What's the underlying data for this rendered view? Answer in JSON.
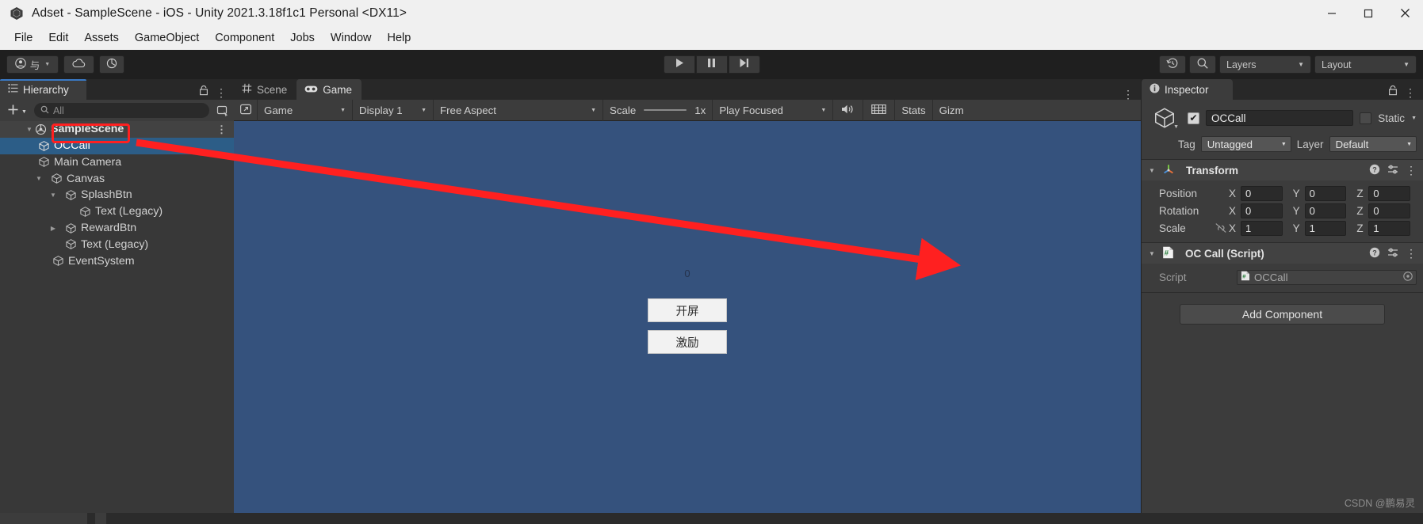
{
  "window": {
    "title": "Adset - SampleScene - iOS - Unity 2021.3.18f1c1 Personal <DX11>",
    "app_icon": "unity-logo-icon",
    "minimize": "minimize-icon",
    "maximize": "maximize-icon",
    "close": "close-icon"
  },
  "menubar": {
    "items": [
      {
        "label": "File"
      },
      {
        "label": "Edit"
      },
      {
        "label": "Assets"
      },
      {
        "label": "GameObject"
      },
      {
        "label": "Component"
      },
      {
        "label": "Jobs"
      },
      {
        "label": "Window"
      },
      {
        "label": "Help"
      }
    ]
  },
  "toolbar": {
    "account_label": "与",
    "account_icon": "account-icon",
    "cloud_icon": "cloud-icon",
    "collab_icon": "collab-icon",
    "play_icon": "play-icon",
    "pause_icon": "pause-icon",
    "step_icon": "step-icon",
    "undo_history_icon": "undo-history-icon",
    "search_icon": "search-icon",
    "layers_label": "Layers",
    "layout_label": "Layout"
  },
  "hierarchy": {
    "tab_label": "Hierarchy",
    "tab_icon": "hierarchy-icon",
    "lock_icon": "lock-icon",
    "kebab_icon": "kebab-icon",
    "create_label": "+",
    "search_placeholder": "All",
    "search_value": "",
    "search_icon": "search-icon",
    "pick_icon": "object-pick-icon",
    "items": [
      {
        "label": "SampleScene",
        "depth": 0,
        "twisty": "down",
        "icon": "scene-icon",
        "state": "scene",
        "kebab": true
      },
      {
        "label": "OCCall",
        "depth": 1,
        "twisty": "none",
        "icon": "gameobject-icon",
        "state": "selected",
        "kebab": false
      },
      {
        "label": "Main Camera",
        "depth": 1,
        "twisty": "none",
        "icon": "gameobject-icon",
        "state": "normal",
        "kebab": false
      },
      {
        "label": "Canvas",
        "depth": 1,
        "twisty": "down",
        "icon": "gameobject-icon",
        "state": "normal",
        "kebab": false
      },
      {
        "label": "SplashBtn",
        "depth": 2,
        "twisty": "down",
        "icon": "gameobject-icon",
        "state": "normal",
        "kebab": false
      },
      {
        "label": "Text (Legacy)",
        "depth": 3,
        "twisty": "none",
        "icon": "gameobject-icon",
        "state": "normal",
        "kebab": false
      },
      {
        "label": "RewardBtn",
        "depth": 2,
        "twisty": "right",
        "icon": "gameobject-icon",
        "state": "normal",
        "kebab": false
      },
      {
        "label": "Text (Legacy)",
        "depth": 2,
        "twisty": "none",
        "icon": "gameobject-icon",
        "state": "normal",
        "kebab": false
      },
      {
        "label": "EventSystem",
        "depth": 1,
        "twisty": "none",
        "icon": "gameobject-icon",
        "state": "normal",
        "kebab": false
      }
    ]
  },
  "center": {
    "tabs": [
      {
        "label": "Scene",
        "icon": "scene-grid-icon",
        "active": false
      },
      {
        "label": "Game",
        "icon": "gamepad-icon",
        "active": true
      }
    ],
    "kebab_icon": "kebab-icon",
    "game_toolbar": {
      "maximize_icon": "maximize-on-play-icon",
      "view_label": "Game",
      "display_label": "Display 1",
      "aspect_label": "Free Aspect",
      "scale_label": "Scale",
      "scale_value": "1x",
      "playmode_label": "Play Focused",
      "mute_icon": "mute-audio-icon",
      "frame_icon": "frame-debugger-icon",
      "stats_label": "Stats",
      "gizmos_label": "Gizm"
    },
    "game_view": {
      "counter": "0",
      "buttons": [
        {
          "label": "开屏"
        },
        {
          "label": "激励"
        }
      ],
      "background_color": "#35527d"
    }
  },
  "inspector": {
    "tab_label": "Inspector",
    "tab_icon": "info-icon",
    "lock_icon": "lock-icon",
    "kebab_icon": "kebab-icon",
    "object": {
      "icon": "gameobject-icon",
      "enabled": true,
      "name": "OCCall",
      "static_label": "Static",
      "static_checked": false,
      "tag_label": "Tag",
      "tag_value": "Untagged",
      "layer_label": "Layer",
      "layer_value": "Default"
    },
    "components": [
      {
        "title": "Transform",
        "icon": "transform-axis-icon",
        "help_icon": "help-icon",
        "preset_icon": "preset-icon",
        "kebab_icon": "kebab-icon",
        "rows": [
          {
            "label": "Position",
            "x": "0",
            "y": "0",
            "z": "0",
            "lock": false
          },
          {
            "label": "Rotation",
            "x": "0",
            "y": "0",
            "z": "0",
            "lock": false
          },
          {
            "label": "Scale",
            "x": "1",
            "y": "1",
            "z": "1",
            "lock": true,
            "lock_icon": "constrain-proportions-off-icon"
          }
        ]
      },
      {
        "title": "OC Call (Script)",
        "icon": "csharp-script-icon",
        "help_icon": "help-icon",
        "preset_icon": "preset-icon",
        "kebab_icon": "kebab-icon",
        "script_label": "Script",
        "script_value": "OCCall",
        "script_value_icon": "csharp-script-icon",
        "script_picker_icon": "object-picker-icon"
      }
    ],
    "add_component_label": "Add Component"
  },
  "annotation": {
    "highlight_color": "#ff2020",
    "arrow_color": "#ff2020",
    "arrow_from": "OCCall hierarchy item",
    "arrow_to": "OC Call (Script) component header"
  },
  "watermark": {
    "text": "CSDN @鹏易灵"
  }
}
